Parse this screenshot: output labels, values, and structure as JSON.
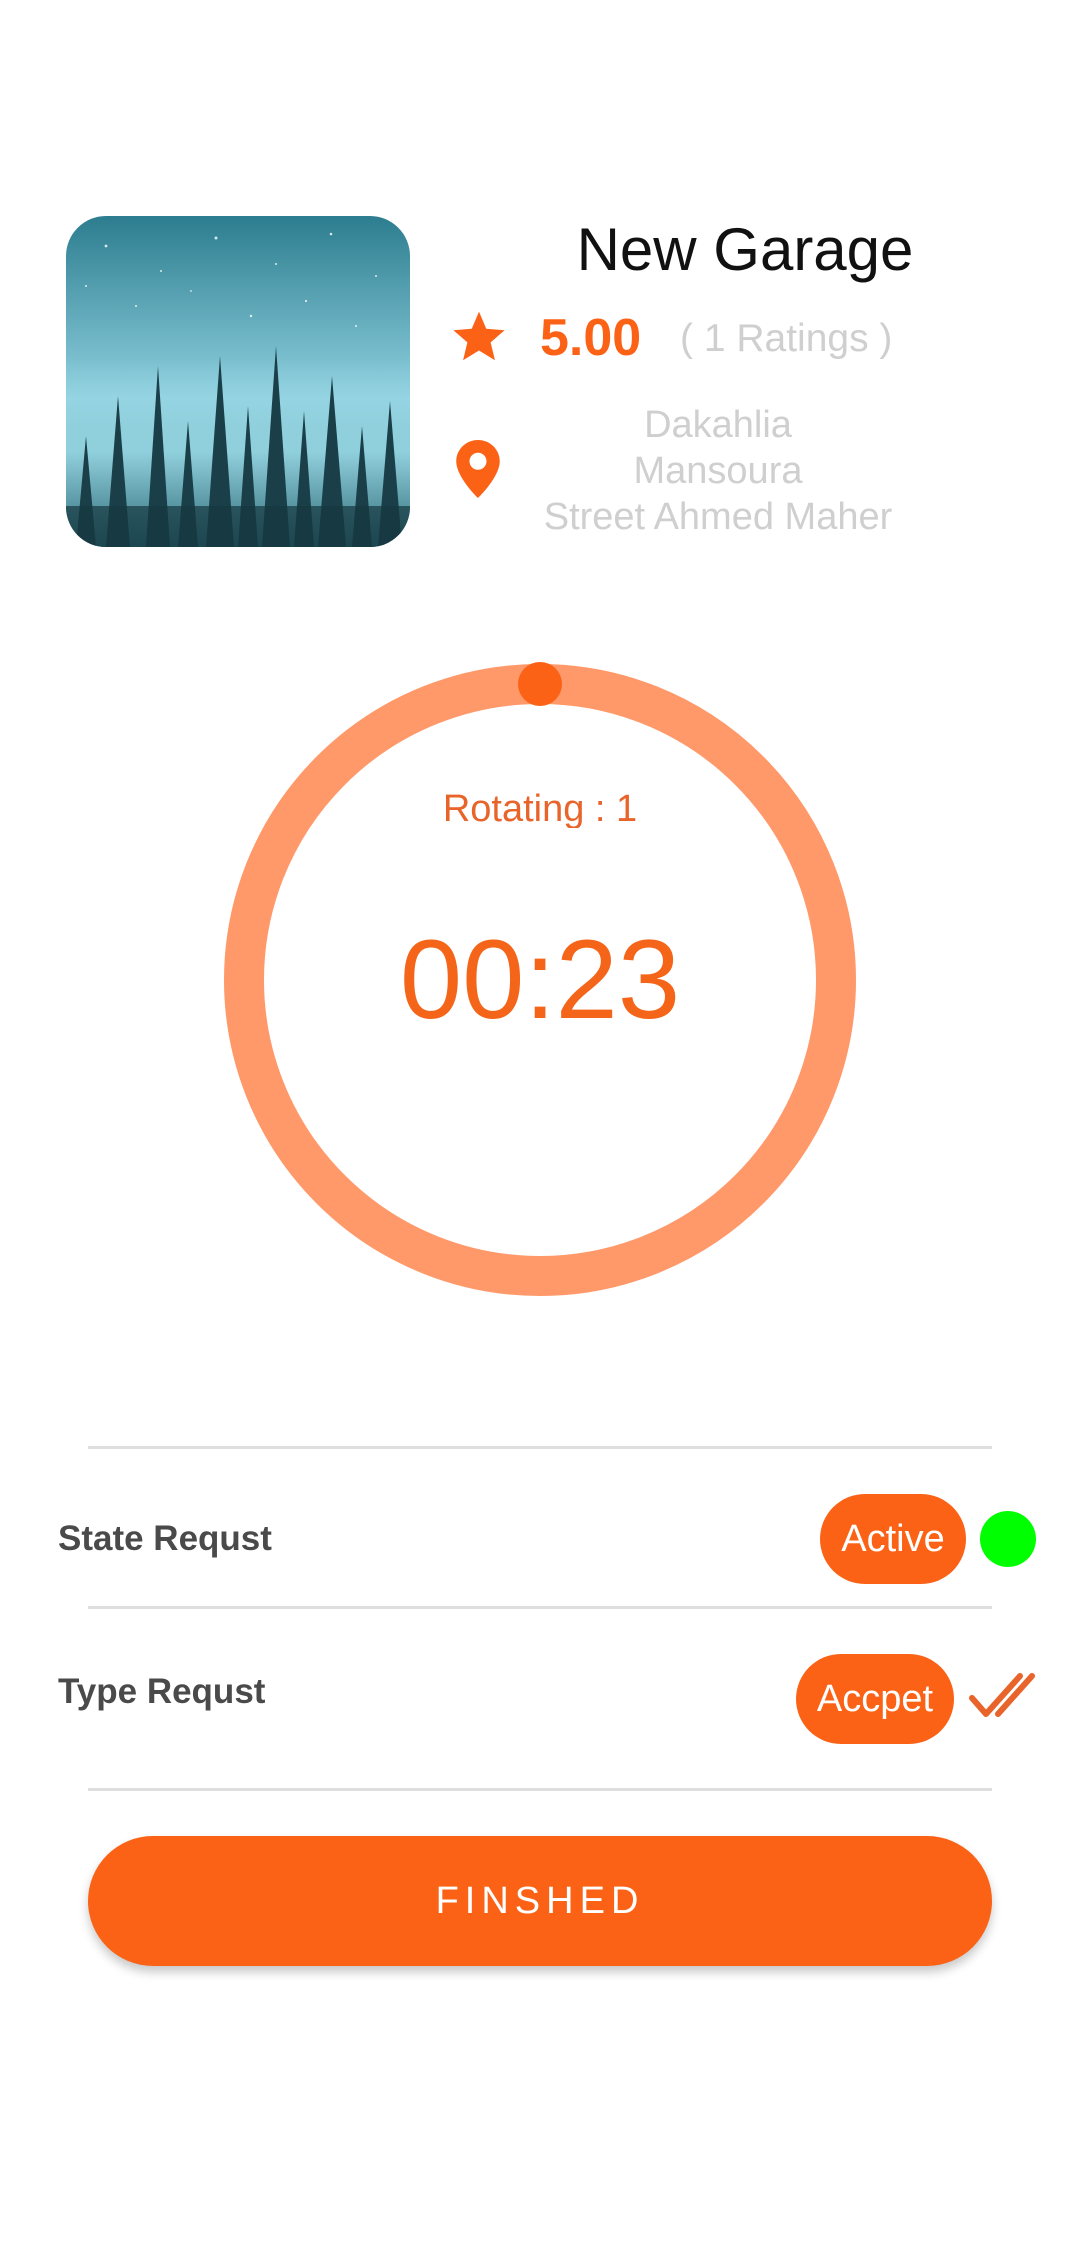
{
  "garage": {
    "name": "New Garage",
    "photo": "night-forest-photo",
    "rating": "5.00",
    "rating_count": "( 1 Ratings )",
    "address_lines": [
      "Dakahlia",
      "Mansoura",
      "Street Ahmed Maher"
    ]
  },
  "timer": {
    "rotating_label": "Rotating : 1",
    "time": "00:23",
    "progress_fraction": 0.0
  },
  "rows": {
    "state": {
      "label": "State Requst",
      "badge": "Active",
      "indicator": "green-status-dot"
    },
    "type": {
      "label": "Type Requst",
      "badge": "Accpet",
      "indicator": "double-check-icon"
    }
  },
  "actions": {
    "finish_label": "FINSHED"
  },
  "colors": {
    "accent": "#FB6216",
    "ring": "#FF996A",
    "text_muted": "#CFCFCF",
    "status_active": "#00FF00"
  }
}
